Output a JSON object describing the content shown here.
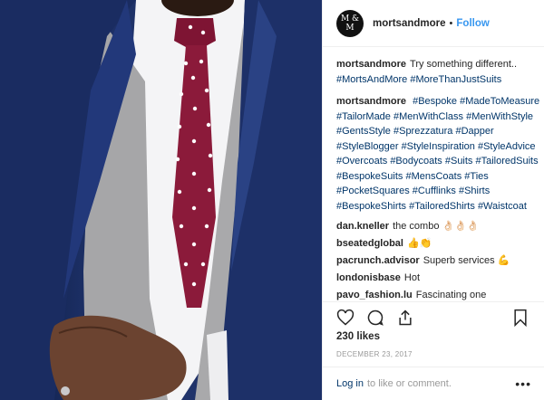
{
  "post": {
    "username": "mortsandmore",
    "follow_label": "Follow",
    "separator": "•",
    "avatar_text": "M & M"
  },
  "caption": {
    "text": "Try something different..",
    "tags_line": [
      "#MortsAndMore",
      "#MoreThanJustSuits"
    ]
  },
  "hashtag_comment": {
    "username": "mortsandmore",
    "tags": [
      "#Bespoke",
      "#MadeToMeasure",
      "#TailorMade",
      "#MenWithClass",
      "#MenWithStyle",
      "#GentsStyle",
      "#Sprezzatura",
      "#Dapper",
      "#StyleBlogger",
      "#StyleInspiration",
      "#StyleAdvice",
      "#Overcoats",
      "#Bodycoats",
      "#Suits",
      "#TailoredSuits",
      "#BespokeSuits",
      "#MensCoats",
      "#Ties",
      "#PocketSquares",
      "#Cufflinks",
      "#Shirts",
      "#BespokeShirts",
      "#TailoredShirts",
      "#Waistcoat"
    ]
  },
  "comments": [
    {
      "username": "dan.kneller",
      "text": "the combo 👌🏻👌🏻👌🏻"
    },
    {
      "username": "bseatedglobal",
      "text": "👍👏"
    },
    {
      "username": "pacrunch.advisor",
      "text": "Superb services 💪"
    },
    {
      "username": "londonisbase",
      "text": "Hot"
    },
    {
      "username": "pavo_fashion.lu",
      "text": "Fascinating one"
    }
  ],
  "likes": "230 likes",
  "date": "DECEMBER 23, 2017",
  "footer": {
    "login_link": "Log in",
    "login_text": "to like or comment.",
    "more": "•••"
  },
  "icons": [
    "heart-icon",
    "comment-icon",
    "share-icon",
    "bookmark-icon",
    "more-options-icon"
  ],
  "colors": {
    "link": "#3897f0",
    "tag": "#003569",
    "muted": "#999999",
    "suit": "#1b2e63",
    "tie": "#8b1a3a"
  }
}
